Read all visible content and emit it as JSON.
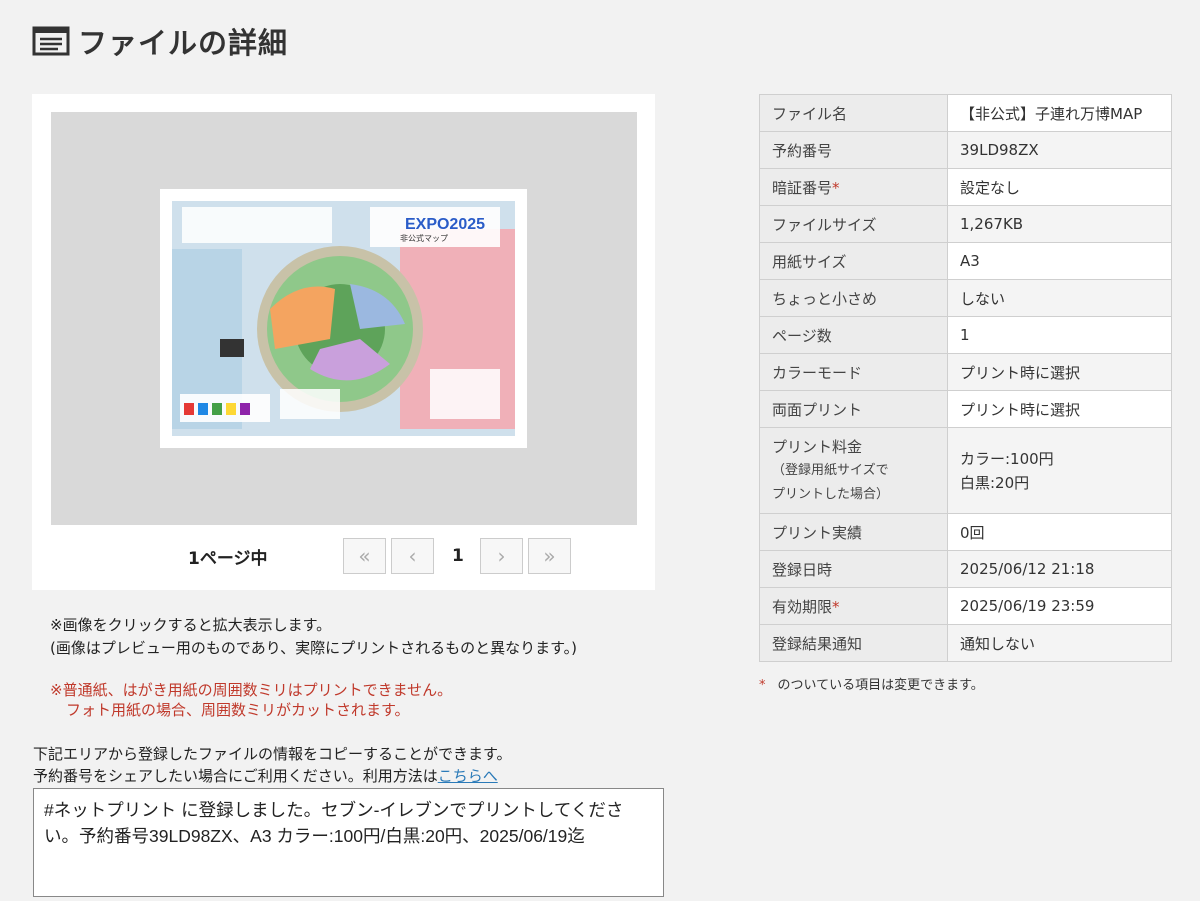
{
  "page": {
    "title": "ファイルの詳細",
    "icon": "document-list-icon"
  },
  "preview": {
    "page_count_label": "1ページ中",
    "current_page": "1",
    "first_label": "«",
    "prev_label": "‹",
    "next_label": "›",
    "last_label": "»",
    "thumb_title": "EXPO2025",
    "thumb_subtitle": "非公式マップ"
  },
  "notes": {
    "click_enlarge": "※画像をクリックすると拡大表示します。",
    "preview_differs": "(画像はプレビュー用のものであり、実際にプリントされるものと異なります。)",
    "margin_warning_1": "※普通紙、はがき用紙の周囲数ミリはプリントできません。",
    "margin_warning_2": "フォト用紙の場合、周囲数ミリがカットされます。"
  },
  "share": {
    "intro_1": "下記エリアから登録したファイルの情報をコピーすることができます。",
    "intro_2": "予約番号をシェアしたい場合にご利用ください。利用方法は",
    "link_label": "こちらへ",
    "text": "#ネットプリント に登録しました。セブン-イレブンでプリントしてください。予約番号39LD98ZX、A3 カラー:100円/白黒:20円、2025/06/19迄"
  },
  "details": {
    "file_name": {
      "label": "ファイル名",
      "value": "【非公式】子連れ万博MAP"
    },
    "reservation_no": {
      "label": "予約番号",
      "value": "39LD98ZX"
    },
    "pin": {
      "label": "暗証番号",
      "value": "設定なし"
    },
    "file_size": {
      "label": "ファイルサイズ",
      "value": "1,267KB"
    },
    "paper_size": {
      "label": "用紙サイズ",
      "value": "A3"
    },
    "slightly_small": {
      "label": "ちょっと小さめ",
      "value": "しない"
    },
    "pages": {
      "label": "ページ数",
      "value": "1"
    },
    "color_mode": {
      "label": "カラーモード",
      "value": "プリント時に選択"
    },
    "duplex": {
      "label": "両面プリント",
      "value": "プリント時に選択"
    },
    "price": {
      "label": "プリント料金",
      "sub_1": "（登録用紙サイズで",
      "sub_2": "プリントした場合）",
      "color": "カラー:100円",
      "mono": "白黒:20円"
    },
    "print_count": {
      "label": "プリント実績",
      "value": "0回"
    },
    "registered": {
      "label": "登録日時",
      "value": "2025/06/12 21:18"
    },
    "expiry": {
      "label": "有効期限",
      "value": "2025/06/19 23:59"
    },
    "notify": {
      "label": "登録結果通知",
      "value": "通知しない"
    },
    "legend": "のついている項目は変更できます。",
    "star": "*"
  },
  "colors": {
    "background": "#f2f2f2",
    "required_star": "#c0392b",
    "link": "#2a7ab8"
  }
}
